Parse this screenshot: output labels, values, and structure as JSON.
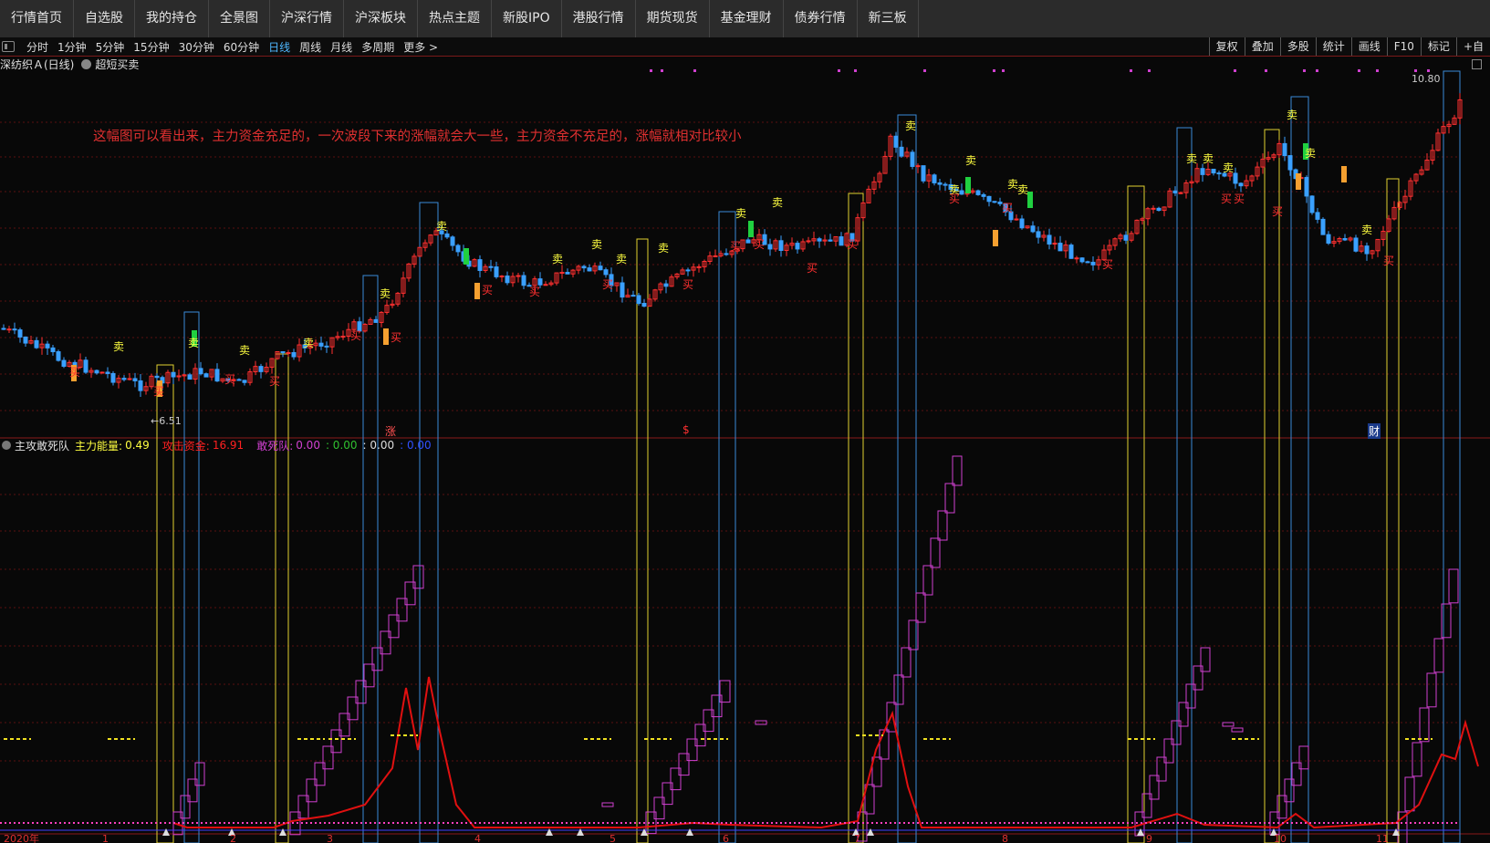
{
  "nav": {
    "items": [
      "行情首页",
      "自选股",
      "我的持仓",
      "全景图",
      "沪深行情",
      "沪深板块",
      "热点主题",
      "新股IPO",
      "港股行情",
      "期货现货",
      "基金理财",
      "债券行情",
      "新三板"
    ]
  },
  "toolbar": {
    "periods": [
      "分时",
      "1分钟",
      "5分钟",
      "15分钟",
      "30分钟",
      "60分钟",
      "日线",
      "周线",
      "月线",
      "多周期",
      "更多 >"
    ],
    "active_period": "日线",
    "tools": [
      "复权",
      "叠加",
      "多股",
      "统计",
      "画线",
      "F10",
      "标记",
      "+自"
    ]
  },
  "chart": {
    "stock_title": "深纺织Ａ(日线)",
    "indicator_name": "超短买卖",
    "annotation": "这幅图可以看出来，主力资金充足的，一次波段下来的涨幅就会大一些，主力资金不充足的，涨幅就相对比较小",
    "high_label": "10.80",
    "low_label": "6.51",
    "buy_label": "买",
    "sell_label": "卖",
    "event_markers": [
      "涨",
      "$",
      "财"
    ]
  },
  "indicator": {
    "name": "主攻敢死队",
    "energy_label": "主力能量:",
    "energy_value": "0.49",
    "attack_label": "攻击资金:",
    "attack_value": "16.91",
    "dare_label": "敢死队:",
    "dare_value": "0.00",
    "v1": ": 0.00",
    "v2": ": 0.00",
    "v3": ": 0.00"
  },
  "xaxis": {
    "labels": [
      "2020年",
      "1",
      "2",
      "3",
      "4",
      "5",
      "6",
      "7",
      "8",
      "9",
      "10",
      "11"
    ]
  },
  "colors": {
    "up": "#ff3030",
    "down": "#3aa0ff",
    "grid": "#5a1010",
    "yellow_box": "#e0d030",
    "blue_box": "#3a8ad8",
    "magenta": "#d040d0",
    "attack_line": "#e01010",
    "buy": "#ff3030",
    "sell": "#ffff40"
  }
}
